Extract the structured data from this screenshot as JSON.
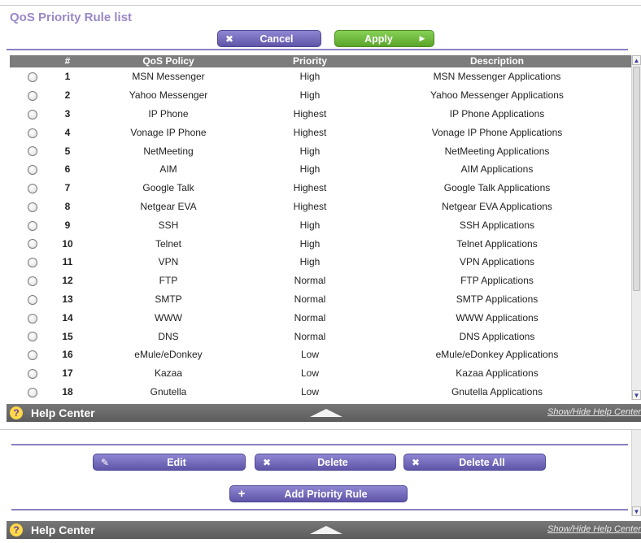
{
  "title": "QoS Priority Rule list",
  "toolbar": {
    "cancel_label": "Cancel",
    "apply_label": "Apply"
  },
  "table": {
    "headers": [
      "",
      "#",
      "QoS Policy",
      "Priority",
      "Description"
    ],
    "rows": [
      {
        "num": "1",
        "policy": "MSN Messenger",
        "priority": "High",
        "description": "MSN Messenger Applications"
      },
      {
        "num": "2",
        "policy": "Yahoo Messenger",
        "priority": "High",
        "description": "Yahoo Messenger Applications"
      },
      {
        "num": "3",
        "policy": "IP Phone",
        "priority": "Highest",
        "description": "IP Phone Applications"
      },
      {
        "num": "4",
        "policy": "Vonage IP Phone",
        "priority": "Highest",
        "description": "Vonage IP Phone Applications"
      },
      {
        "num": "5",
        "policy": "NetMeeting",
        "priority": "High",
        "description": "NetMeeting Applications"
      },
      {
        "num": "6",
        "policy": "AIM",
        "priority": "High",
        "description": "AIM Applications"
      },
      {
        "num": "7",
        "policy": "Google Talk",
        "priority": "Highest",
        "description": "Google Talk Applications"
      },
      {
        "num": "8",
        "policy": "Netgear EVA",
        "priority": "Highest",
        "description": "Netgear EVA Applications"
      },
      {
        "num": "9",
        "policy": "SSH",
        "priority": "High",
        "description": "SSH Applications"
      },
      {
        "num": "10",
        "policy": "Telnet",
        "priority": "High",
        "description": "Telnet Applications"
      },
      {
        "num": "11",
        "policy": "VPN",
        "priority": "High",
        "description": "VPN Applications"
      },
      {
        "num": "12",
        "policy": "FTP",
        "priority": "Normal",
        "description": "FTP Applications"
      },
      {
        "num": "13",
        "policy": "SMTP",
        "priority": "Normal",
        "description": "SMTP Applications"
      },
      {
        "num": "14",
        "policy": "WWW",
        "priority": "Normal",
        "description": "WWW Applications"
      },
      {
        "num": "15",
        "policy": "DNS",
        "priority": "Normal",
        "description": "DNS Applications"
      },
      {
        "num": "16",
        "policy": "eMule/eDonkey",
        "priority": "Low",
        "description": "eMule/eDonkey Applications"
      },
      {
        "num": "17",
        "policy": "Kazaa",
        "priority": "Low",
        "description": "Kazaa Applications"
      },
      {
        "num": "18",
        "policy": "Gnutella",
        "priority": "Low",
        "description": "Gnutella Applications"
      }
    ]
  },
  "help": {
    "label": "Help Center",
    "link": "Show/Hide Help Center"
  },
  "actions": {
    "edit_label": "Edit",
    "delete_label": "Delete",
    "delete_all_label": "Delete All",
    "add_rule_label": "Add Priority Rule"
  },
  "icons": {
    "cancel": "close-icon",
    "apply": "arrow-right-icon",
    "edit": "pencil-icon",
    "delete": "close-icon",
    "add": "plus-icon",
    "help": "question-icon"
  },
  "colors": {
    "accent": "#6b5fb5",
    "apply_green": "#6dbb3a",
    "header_gray": "#7c7c7c"
  }
}
